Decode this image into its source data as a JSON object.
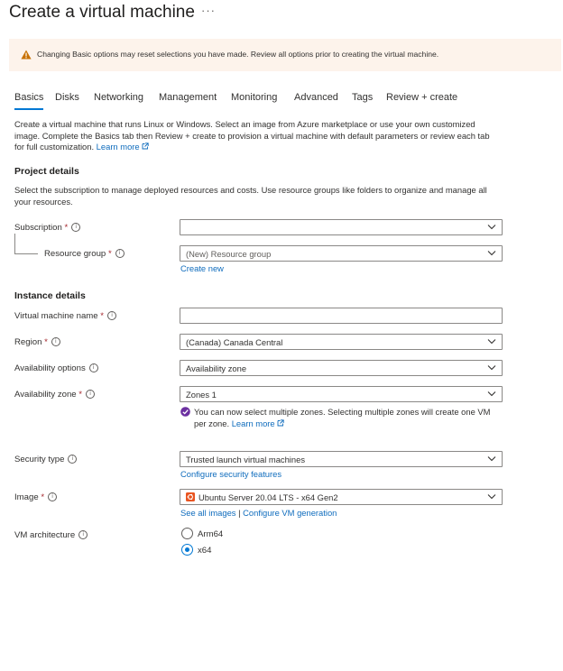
{
  "header": {
    "title": "Create a virtual machine",
    "more": "···"
  },
  "banner": {
    "text": "Changing Basic options may reset selections you have made. Review all options prior to creating the virtual machine."
  },
  "tabs": [
    "Basics",
    "Disks",
    "Networking",
    "Management",
    "Monitoring",
    "Advanced",
    "Tags",
    "Review + create"
  ],
  "intro": {
    "text": "Create a virtual machine that runs Linux or Windows. Select an image from Azure marketplace or use your own customized image. Complete the Basics tab then Review + create to provision a virtual machine with default parameters or review each tab for full customization.",
    "learn_more": "Learn more"
  },
  "project": {
    "heading": "Project details",
    "description": "Select the subscription to manage deployed resources and costs. Use resource groups like folders to organize and manage all your resources.",
    "subscription_label": "Subscription",
    "subscription_value": "",
    "resource_group_label": "Resource group",
    "resource_group_value": "(New) Resource group",
    "create_new": "Create new"
  },
  "instance": {
    "heading": "Instance details",
    "vm_name_label": "Virtual machine name",
    "vm_name_value": "",
    "region_label": "Region",
    "region_value": "(Canada) Canada Central",
    "availability_options_label": "Availability options",
    "availability_options_value": "Availability zone",
    "availability_zone_label": "Availability zone",
    "availability_zone_value": "Zones 1",
    "zone_note": "You can now select multiple zones. Selecting multiple zones will create one VM per zone.",
    "zone_note_link": "Learn more",
    "security_type_label": "Security type",
    "security_type_value": "Trusted launch virtual machines",
    "configure_security": "Configure security features",
    "image_label": "Image",
    "image_value": "Ubuntu Server 20.04 LTS - x64 Gen2",
    "see_all_images": "See all images",
    "link_separator": "|",
    "configure_vm_generation": "Configure VM generation",
    "vm_architecture_label": "VM architecture",
    "arch_options": [
      "Arm64",
      "x64"
    ],
    "arch_selected": "x64"
  },
  "required_marker": "*",
  "info_glyph": "i",
  "colors": {
    "accent": "#0078d4",
    "link": "#0f6cbd",
    "required": "#a4262c",
    "banner_bg": "#fdf3eb",
    "warning": "#c87000",
    "ubuntu": "#e95420",
    "success": "#6b2fa0"
  }
}
